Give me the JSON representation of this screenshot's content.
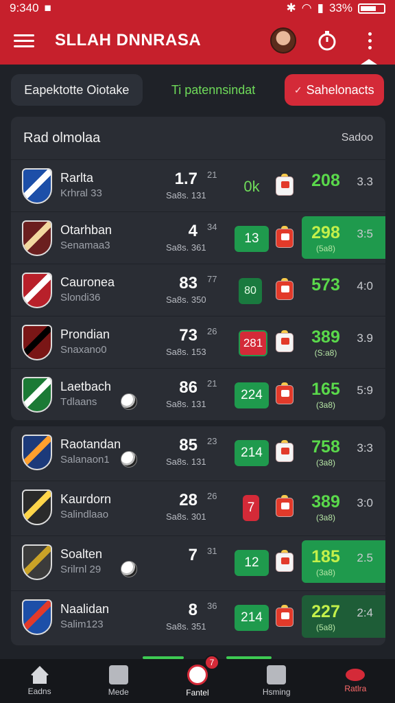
{
  "status": {
    "time": "9:340",
    "battery": "33%"
  },
  "appbar": {
    "title": "SLLAH DNNRASA",
    "menu_icon": "menu-icon",
    "timer_icon": "stopwatch-icon",
    "more_icon": "more-vert-icon"
  },
  "filters": {
    "left": "Eapektotte Oiotake",
    "middle": "Ti patennsindat",
    "right": "Sahelonacts"
  },
  "panel": {
    "title": "Rad olmolaa",
    "right": "Sadoo"
  },
  "rows": [
    {
      "name": "Rarlta",
      "sub": "Krhral 33",
      "score": "1.7",
      "score_sub": "Sa8s. 131",
      "small": "21",
      "badge": "0k",
      "badge_style": "plain",
      "shirt": "white",
      "val": "208",
      "val_sub": "",
      "last": "3.3",
      "hl": ""
    },
    {
      "name": "Otarhban",
      "sub": "Senamaa3",
      "score": "4",
      "score_sub": "Sa8s. 361",
      "small": "34",
      "badge": "13",
      "badge_style": "green",
      "shirt": "red",
      "val": "298",
      "val_sub": "(5a8)",
      "last": "3:5",
      "hl": "green"
    },
    {
      "name": "Cauronea",
      "sub": "Slondi36",
      "score": "83",
      "score_sub": "Sa8s. 350",
      "small": "77",
      "badge": "80",
      "badge_style": "greenol",
      "shirt": "red",
      "val": "573",
      "val_sub": "",
      "last": "4:0",
      "hl": ""
    },
    {
      "name": "Prondian",
      "sub": "Snaxano0",
      "score": "73",
      "score_sub": "Sa8s. 153",
      "small": "26",
      "badge": "281",
      "badge_style": "redbox",
      "shirt": "white",
      "val": "389",
      "val_sub": "(S:a8)",
      "last": "3.9",
      "hl": ""
    },
    {
      "name": "Laetbach",
      "sub": "Tdlaans",
      "score": "86",
      "score_sub": "Sa8s. 131",
      "small": "21",
      "badge": "224",
      "badge_style": "green",
      "shirt": "red",
      "val": "165",
      "val_sub": "(3a8)",
      "last": "5:9",
      "hl": ""
    },
    {
      "name": "Raotandan",
      "sub": "Salanaon1",
      "score": "85",
      "score_sub": "Sa8s. 131",
      "small": "23",
      "badge": "214",
      "badge_style": "green",
      "shirt": "white",
      "val": "758",
      "val_sub": "(3a8)",
      "last": "3:3",
      "hl": ""
    },
    {
      "name": "Kaurdorn",
      "sub": "Salindlaao",
      "score": "28",
      "score_sub": "Sa8s. 301",
      "small": "26",
      "badge": "7",
      "badge_style": "red",
      "shirt": "red",
      "val": "389",
      "val_sub": "(3a8)",
      "last": "3:0",
      "hl": ""
    },
    {
      "name": "Soalten",
      "sub": "Srilrnl 29",
      "score": "7",
      "score_sub": "",
      "small": "31",
      "badge": "12",
      "badge_style": "green",
      "shirt": "white",
      "val": "185",
      "val_sub": "(3a8)",
      "last": "2.5",
      "hl": "green"
    },
    {
      "name": "Naalidan",
      "sub": "Salim123",
      "score": "8",
      "score_sub": "Sa8s. 351",
      "small": "36",
      "badge": "214",
      "badge_style": "green",
      "shirt": "red",
      "val": "227",
      "val_sub": "(5a8)",
      "last": "2:4",
      "hl": "dark"
    }
  ],
  "nav": [
    {
      "label": "Eadns",
      "icon": "home-icon"
    },
    {
      "label": "Mede",
      "icon": "grid-icon"
    },
    {
      "label": "Fantel",
      "icon": "whistle-icon"
    },
    {
      "label": "Hsming",
      "icon": "profile-icon"
    },
    {
      "label": "Ratlra",
      "icon": "flame-icon"
    }
  ],
  "nav_badge": "7",
  "colors": {
    "accent": "#c6202c",
    "green": "#1f9a4d",
    "bg": "#1f2228",
    "panel": "#2a2d34"
  }
}
